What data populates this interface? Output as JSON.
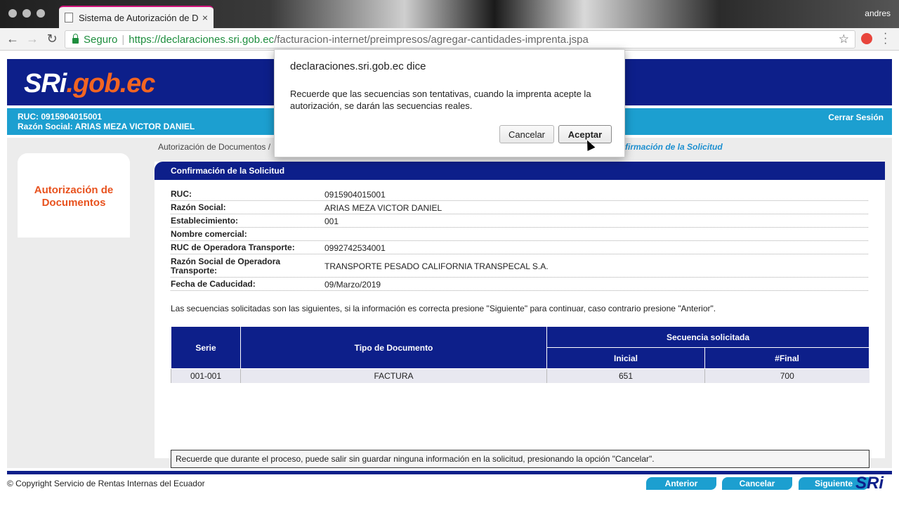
{
  "browser": {
    "tab_title": "Sistema de Autorización de Do",
    "tab_close": "×",
    "user": "andres",
    "secure_label": "Seguro",
    "url_host": "https://declaraciones.sri.gob.ec",
    "url_path": "/facturacion-internet/preimpresos/agregar-cantidades-imprenta.jspa"
  },
  "header": {
    "logo_sri": "SRi",
    "logo_dot": ".",
    "logo_gob": "gob",
    "logo_ec": ".ec",
    "ruc": "RUC: 0915904015001",
    "razon": "Razón Social: ARIAS MEZA VICTOR DANIEL",
    "logout": "Cerrar Sesión"
  },
  "sidebar": {
    "title": "Autorización de Documentos"
  },
  "breadcrumb": {
    "left": "Autorización de Documentos / ",
    "right": "firmación de la Solicitud"
  },
  "panel": {
    "title": "Confirmación de la Solicitud",
    "fields": [
      {
        "label": "RUC:",
        "value": "0915904015001"
      },
      {
        "label": "Razón Social:",
        "value": "ARIAS MEZA VICTOR DANIEL"
      },
      {
        "label": "Establecimiento:",
        "value": "001"
      },
      {
        "label": "Nombre comercial:",
        "value": ""
      },
      {
        "label": "RUC de Operadora Transporte:",
        "value": "0992742534001"
      },
      {
        "label": "Razón Social de Operadora Transporte:",
        "value": "TRANSPORTE PESADO CALIFORNIA TRANSPECAL S.A."
      },
      {
        "label": "Fecha de Caducidad:",
        "value": "09/Marzo/2019"
      }
    ],
    "notice": "Las secuencias solicitadas son las siguientes, si la información es correcta presione \"Siguiente\" para continuar, caso contrario presione \"Anterior\".",
    "table": {
      "col_serie": "Serie",
      "col_tipo": "Tipo de Documento",
      "col_secuencia": "Secuencia solicitada",
      "col_inicial": "Inicial",
      "col_final": "#Final",
      "rows": [
        {
          "serie": "001-001",
          "tipo": "FACTURA",
          "inicial": "651",
          "final": "700"
        }
      ]
    },
    "note": "Recuerde que durante el proceso, puede salir sin guardar ninguna información en la solicitud, presionando la opción \"Cancelar\".",
    "btn_prev": "Anterior",
    "btn_cancel": "Cancelar",
    "btn_next": "Siguiente"
  },
  "footer": {
    "copyright": "© Copyright Servicio de Rentas Internas del Ecuador",
    "logo": "SRi"
  },
  "dialog": {
    "title": "declaraciones.sri.gob.ec dice",
    "message": "Recuerde que las secuencias son tentativas, cuando la imprenta acepte la autorización, se darán las secuencias reales.",
    "cancel": "Cancelar",
    "accept": "Aceptar"
  },
  "colors": {
    "navy": "#0d1f8a",
    "cyan": "#1c9fd0",
    "orange": "#e8521e",
    "secure_green": "#1e8e3e"
  }
}
